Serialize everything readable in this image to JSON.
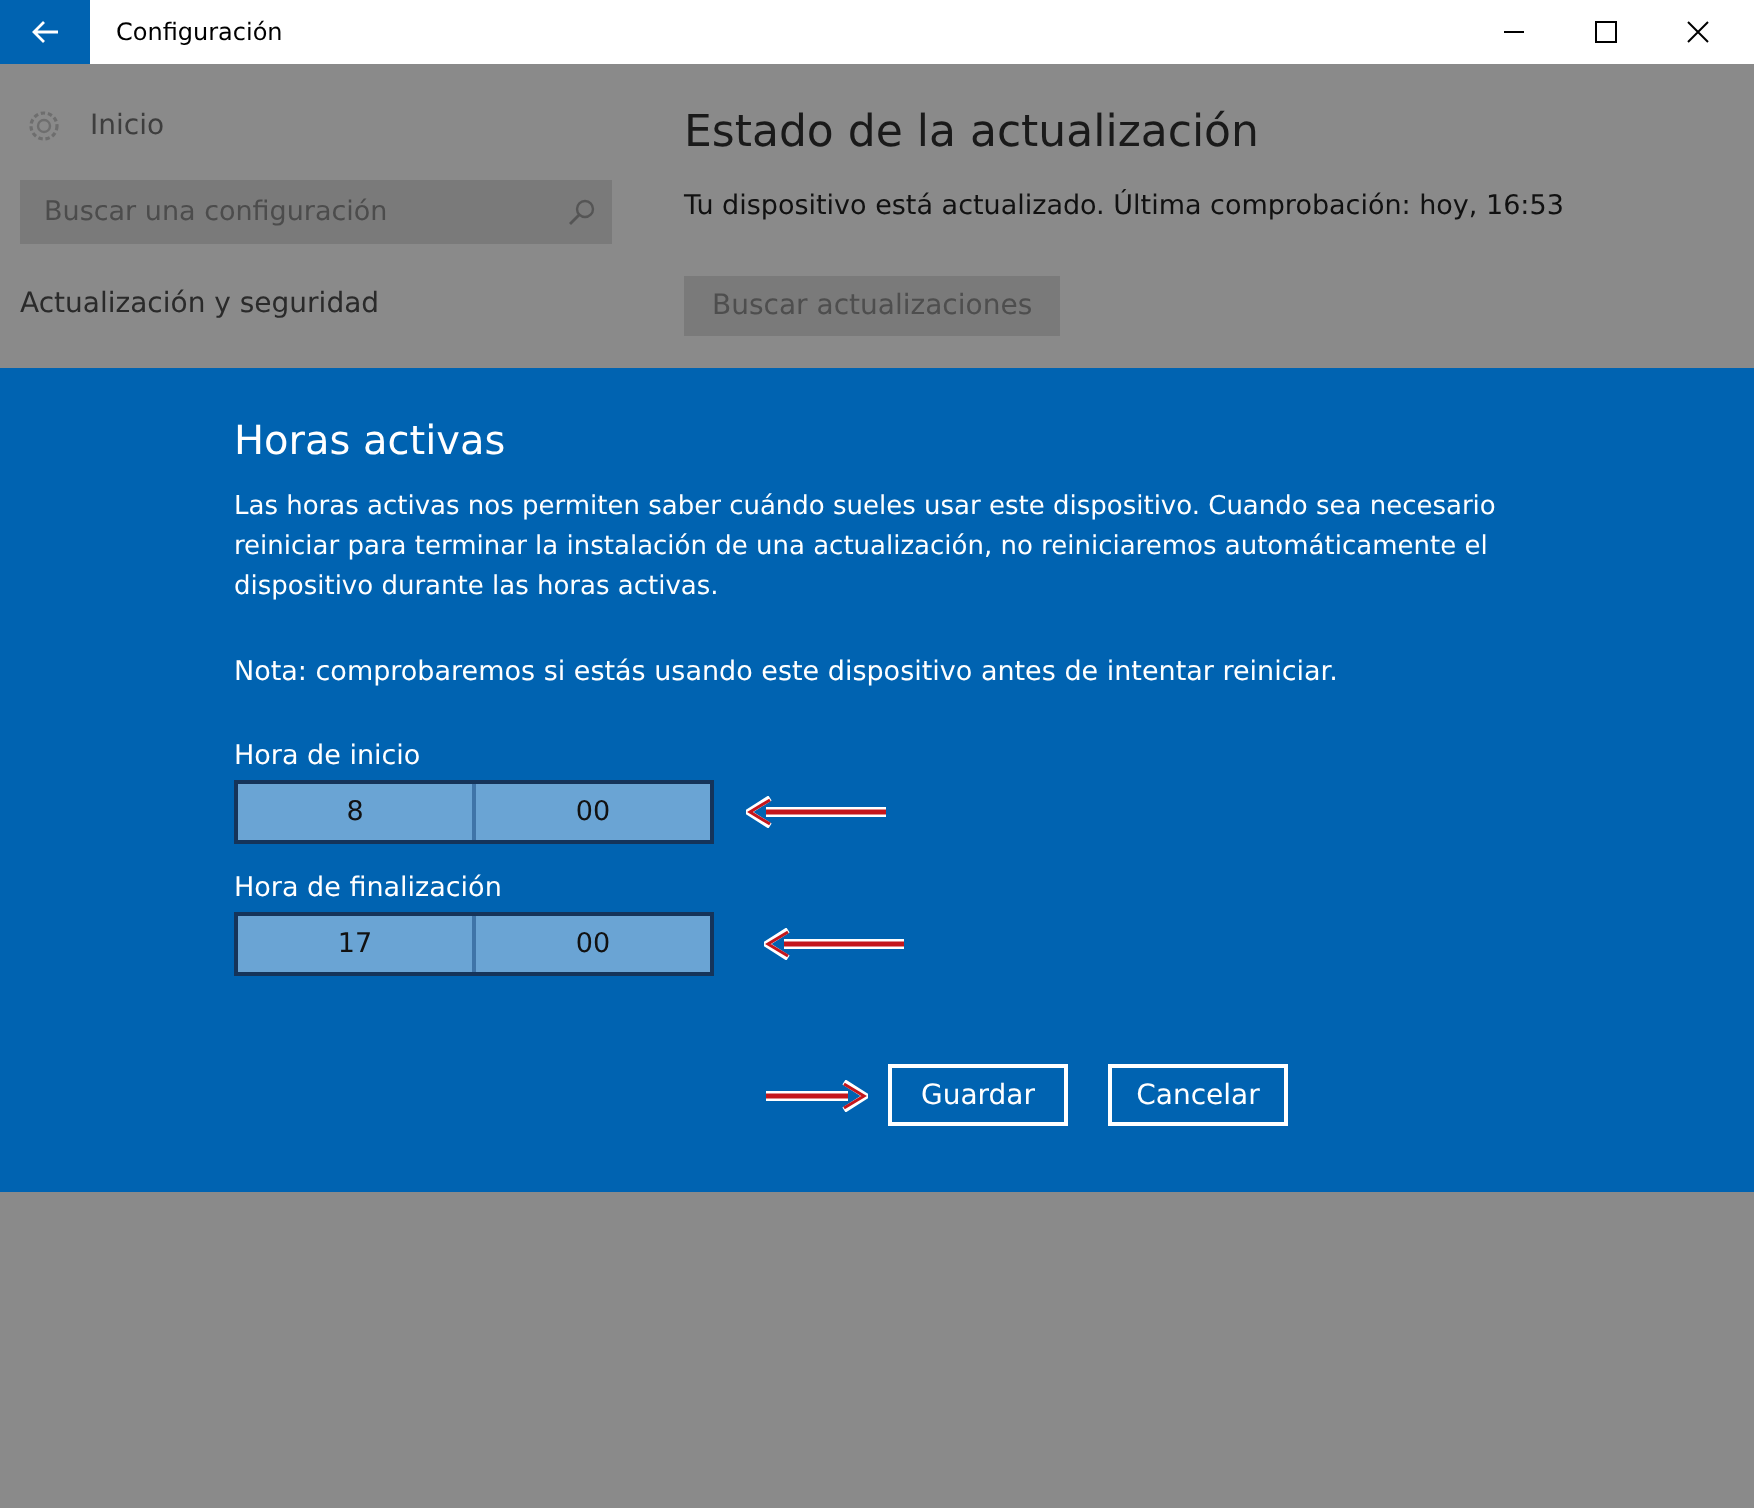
{
  "window": {
    "title": "Configuración"
  },
  "sidebar": {
    "home": "Inicio",
    "search": {
      "placeholder": "Buscar una configuración"
    },
    "section": "Actualización y seguridad"
  },
  "main": {
    "heading": "Estado de la actualización",
    "status": "Tu dispositivo está actualizado. Última comprobación: hoy, 16:53",
    "button": "Buscar actualizaciones"
  },
  "dialog": {
    "title": "Horas activas",
    "description": "Las horas activas nos permiten saber cuándo sueles usar este dispositivo. Cuando sea necesario reiniciar para terminar la instalación de una actualización, no reiniciaremos automáticamente el dispositivo durante las horas activas.",
    "note": "Nota: comprobaremos si estás usando este dispositivo antes de intentar reiniciar.",
    "fields": [
      {
        "label": "Hora de inicio",
        "hour": "8",
        "minute": "00"
      },
      {
        "label": "Hora de finalización",
        "hour": "17",
        "minute": "00"
      }
    ],
    "buttons": [
      "Guardar",
      "Cancelar"
    ]
  }
}
